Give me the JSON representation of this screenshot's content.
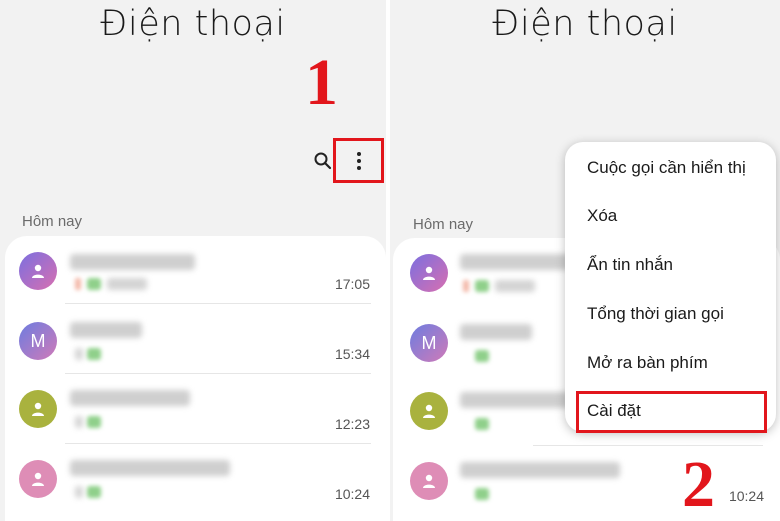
{
  "app_title": "Điện thoại",
  "steps": {
    "first": "1",
    "second": "2"
  },
  "section_label": "Hôm nay",
  "icons": {
    "search": "search-icon",
    "more": "more-vertical-icon",
    "contact": "person-icon"
  },
  "colors": {
    "highlight": "#e2161c"
  },
  "calls": [
    {
      "avatar_initial": "",
      "avatar_color": "linear-gradient(135deg,#7b6fe0,#d86fb0)",
      "time": "17:05"
    },
    {
      "avatar_initial": "M",
      "avatar_color": "linear-gradient(135deg,#6d7de0,#d07ab8)",
      "time": "15:34"
    },
    {
      "avatar_initial": "",
      "avatar_color": "#a9b23e",
      "time": "12:23"
    },
    {
      "avatar_initial": "",
      "avatar_color": "#de8db6",
      "time": "10:24"
    }
  ],
  "menu": {
    "items": [
      "Cuộc gọi cần hiển thị",
      "Xóa",
      "Ẩn tin nhắn",
      "Tổng thời gian gọi",
      "Mở ra bàn phím",
      "Cài đặt"
    ],
    "highlighted_item": "Cài đặt"
  }
}
